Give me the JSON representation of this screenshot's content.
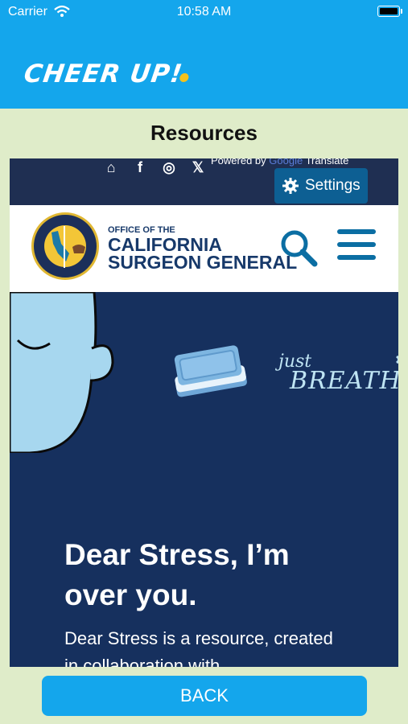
{
  "status": {
    "carrier": "Carrier",
    "time": "10:58 AM"
  },
  "app": {
    "title": "CHEER UP!"
  },
  "page": {
    "title": "Resources"
  },
  "webview": {
    "util_icons": [
      "home-icon",
      "facebook-icon",
      "instagram-icon",
      "x-icon"
    ],
    "powered_by": "Powered by",
    "powered_google": "Google",
    "powered_translate": "Translate",
    "settings_label": "Settings",
    "org_small": "OFFICE OF THE",
    "org_big_line1": "CALIFORNIA",
    "org_big_line2": "SURGEON GENERAL",
    "breathe_just": "just",
    "breathe_big": "BREATHE",
    "headline": "Dear Stress, I’m over you.",
    "description": "Dear Stress is a resource, created in collaboration with"
  },
  "footer": {
    "back_label": "BACK"
  },
  "colors": {
    "brand": "#14a6ec",
    "background": "#dfecc9",
    "web_navy": "#152c55",
    "seal_gold": "#e0b732"
  }
}
